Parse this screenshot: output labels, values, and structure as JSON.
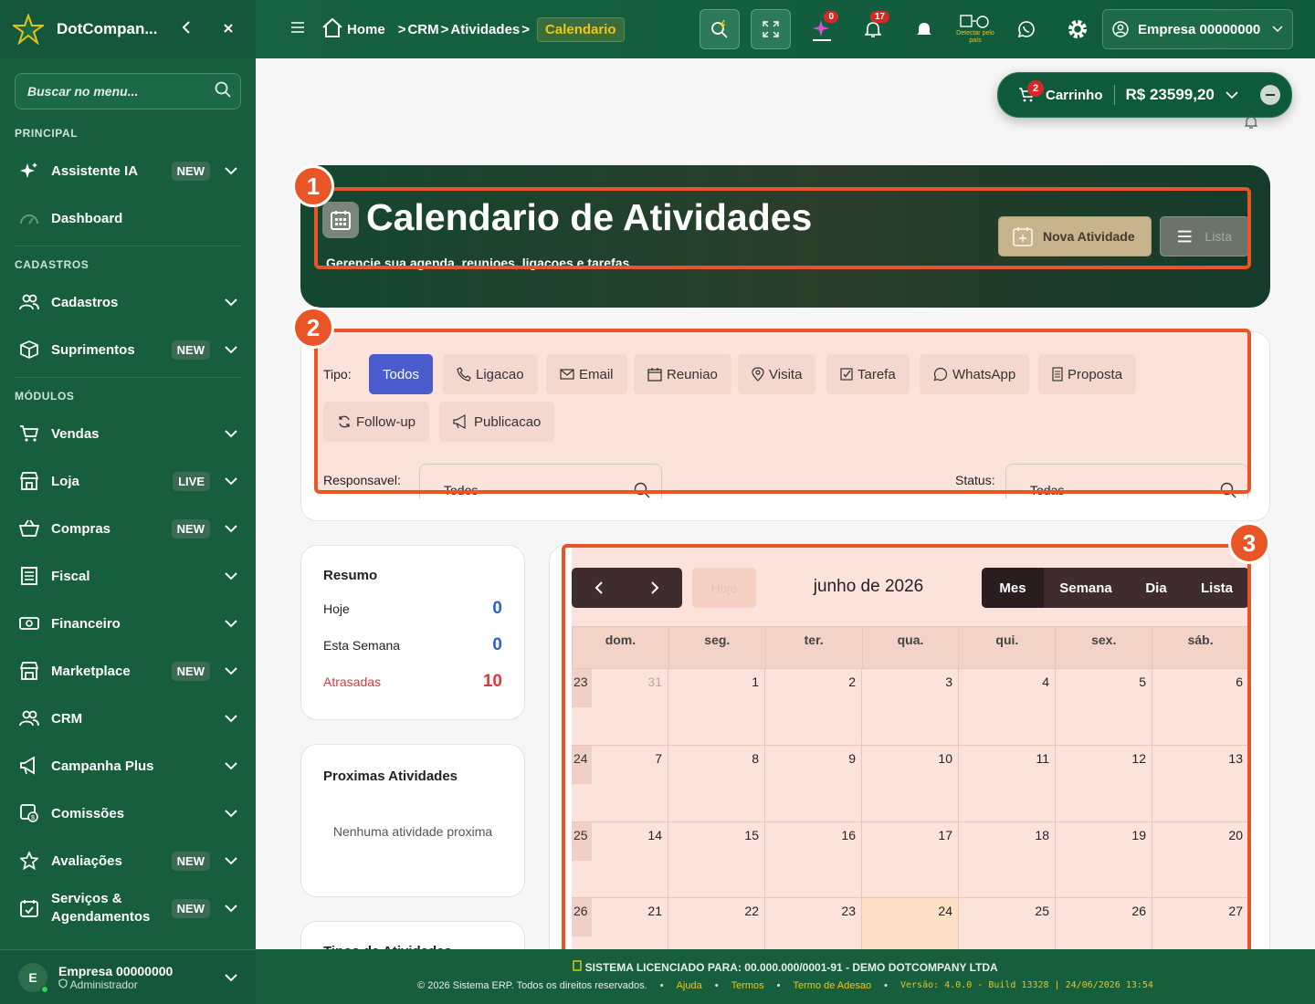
{
  "sidebar": {
    "app_title": "DotCompan...",
    "search_placeholder": "Buscar no menu...",
    "sections": {
      "principal": "PRINCIPAL",
      "cadastros": "CADASTROS",
      "modulos": "MÓDULOS"
    },
    "items": [
      {
        "label": "Assistente IA",
        "badge": "NEW"
      },
      {
        "label": "Dashboard",
        "badge": ""
      },
      {
        "label": "Cadastros",
        "badge": ""
      },
      {
        "label": "Suprimentos",
        "badge": "NEW"
      },
      {
        "label": "Vendas",
        "badge": ""
      },
      {
        "label": "Loja",
        "badge": "LIVE"
      },
      {
        "label": "Compras",
        "badge": "NEW"
      },
      {
        "label": "Fiscal",
        "badge": ""
      },
      {
        "label": "Financeiro",
        "badge": ""
      },
      {
        "label": "Marketplace",
        "badge": "NEW"
      },
      {
        "label": "CRM",
        "badge": ""
      },
      {
        "label": "Campanha Plus",
        "badge": ""
      },
      {
        "label": "Comissões",
        "badge": ""
      },
      {
        "label": "Avaliações",
        "badge": "NEW"
      },
      {
        "label": "Serviços & Agendamentos",
        "badge": "NEW"
      }
    ],
    "user": {
      "initial": "E",
      "name": "Empresa 00000000",
      "role": "Administrador"
    }
  },
  "topbar": {
    "breadcrumb": {
      "home": "Home",
      "crm": "CRM",
      "atividades": "Atividades",
      "current": "Calendario"
    },
    "ai_count": "0",
    "notif_count": "17",
    "detect_label": "Detectar pelo país",
    "company": "Empresa 00000000"
  },
  "cart": {
    "count": "2",
    "label": "Carrinho",
    "amount": "R$ 23599,20"
  },
  "hero": {
    "title": "Calendario de Atividades",
    "subtitle": "Gerencie sua agenda, reunioes, ligacoes e tarefas",
    "new_button": "Nova Atividade",
    "list_button": "Lista"
  },
  "annotations": [
    "1",
    "2",
    "3"
  ],
  "filters": {
    "tipo_label": "Tipo:",
    "types": [
      "Todos",
      "Ligacao",
      "Email",
      "Reuniao",
      "Visita",
      "Tarefa",
      "WhatsApp",
      "Proposta",
      "Follow-up",
      "Publicacao"
    ],
    "responsavel_label": "Responsavel:",
    "responsavel_value": "Todos",
    "status_label": "Status:",
    "status_value": "Todas"
  },
  "summary": {
    "title": "Resumo",
    "rows": [
      {
        "label": "Hoje",
        "value": "0"
      },
      {
        "label": "Esta Semana",
        "value": "0"
      },
      {
        "label": "Atrasadas",
        "value": "10"
      }
    ]
  },
  "upcoming": {
    "title": "Proximas Atividades",
    "empty": "Nenhuma atividade proxima",
    "next_title": "Tipos de Atividades"
  },
  "calendar": {
    "today_button": "Hoje",
    "title": "junho de 2026",
    "views": [
      "Mes",
      "Semana",
      "Dia",
      "Lista"
    ],
    "weekdays": [
      "dom.",
      "seg.",
      "ter.",
      "qua.",
      "qui.",
      "sex.",
      "sáb."
    ],
    "weeks": [
      {
        "week": "23",
        "days": [
          "31",
          "1",
          "2",
          "3",
          "4",
          "5",
          "6"
        ]
      },
      {
        "week": "24",
        "days": [
          "7",
          "8",
          "9",
          "10",
          "11",
          "12",
          "13"
        ]
      },
      {
        "week": "25",
        "days": [
          "14",
          "15",
          "16",
          "17",
          "18",
          "19",
          "20"
        ]
      },
      {
        "week": "26",
        "days": [
          "21",
          "22",
          "23",
          "24",
          "25",
          "26",
          "27"
        ]
      }
    ]
  },
  "footer": {
    "license": "SISTEMA LICENCIADO PARA: 00.000.000/0001-91 - DEMO DOTCOMPANY LTDA",
    "copyright": "© 2026 Sistema ERP. Todos os direitos reservados.",
    "links": [
      "Ajuda",
      "Termos",
      "Termo de Adesao"
    ],
    "version": "Versão: 4.0.0 - Build 13328 | 24/06/2026 13:54"
  }
}
